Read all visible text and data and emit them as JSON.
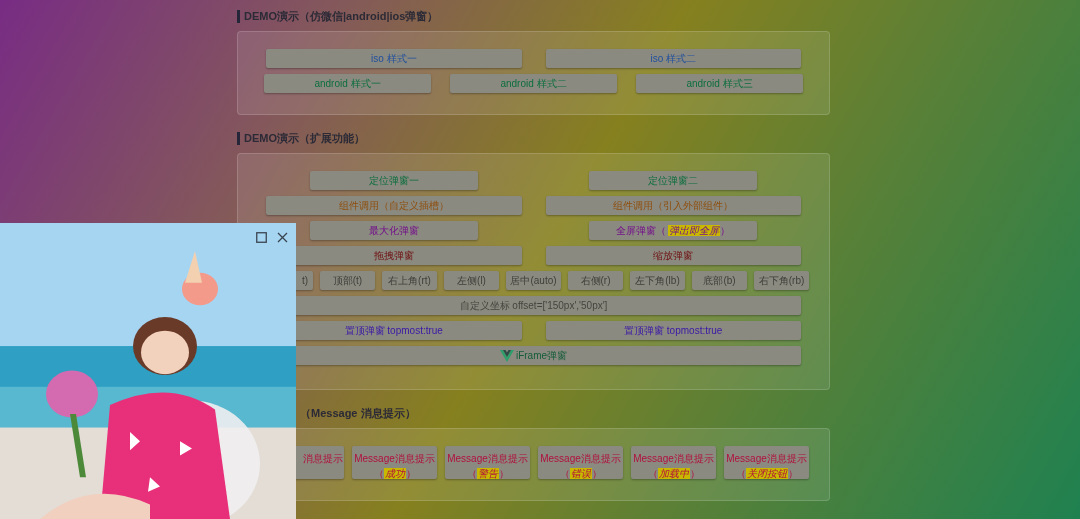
{
  "sections": [
    {
      "title": "DEMO演示（仿微信|android|ios弹窗）",
      "rows": [
        {
          "kind": "halves",
          "buttons": [
            {
              "label": "iso 样式一"
            },
            {
              "label": "iso 样式二"
            }
          ]
        },
        {
          "kind": "thirds",
          "buttons": [
            {
              "label": "android 样式一"
            },
            {
              "label": "android 样式二"
            },
            {
              "label": "android 样式三"
            }
          ]
        }
      ]
    },
    {
      "title": "DEMO演示（扩展功能）",
      "rows": [
        {
          "kind": "narrow",
          "buttons": [
            {
              "label": "定位弹窗一"
            },
            {
              "label": "定位弹窗二"
            }
          ]
        },
        {
          "kind": "halves",
          "buttons": [
            {
              "label": "组件调用（自定义插槽）"
            },
            {
              "label": "组件调用（引入外部组件）"
            }
          ]
        },
        {
          "kind": "narrow",
          "buttons": [
            {
              "label": "最大化弹窗"
            },
            {
              "label": "全屏弹窗（",
              "note": {
                "text": "弹出即全屏",
                "after": "）"
              }
            }
          ]
        },
        {
          "kind": "halves",
          "buttons": [
            {
              "label": "拖拽弹窗"
            },
            {
              "label": "缩放弹窗"
            }
          ]
        },
        {
          "kind": "positions",
          "buttons": [
            {
              "label": "t)"
            },
            {
              "label": "顶部(t)"
            },
            {
              "label": "右上角(rt)"
            },
            {
              "label": "左侧(l)"
            },
            {
              "label": "居中(auto)"
            },
            {
              "label": "右侧(r)"
            },
            {
              "label": "左下角(lb)"
            },
            {
              "label": "底部(b)"
            },
            {
              "label": "右下角(rb)"
            }
          ]
        },
        {
          "kind": "full",
          "buttons": [
            {
              "label": "自定义坐标 offset=['150px','50px']"
            }
          ]
        },
        {
          "kind": "halves",
          "buttons": [
            {
              "label": "置顶弹窗 topmost:true"
            },
            {
              "label": "置顶弹窗 topmost:true"
            }
          ]
        },
        {
          "kind": "full",
          "buttons": [
            {
              "label": "iFrame弹窗"
            }
          ]
        }
      ]
    },
    {
      "title": "（Message 消息提示）",
      "rows": [
        {
          "kind": "messages",
          "buttons": [
            {
              "label": "消息提示"
            },
            {
              "label": "Message消息提示",
              "note": {
                "before": "（",
                "text": "成功",
                "after": "）"
              }
            },
            {
              "label": "Message消息提示",
              "note": {
                "before": "（",
                "text": "警告",
                "after": "）"
              }
            },
            {
              "label": "Message消息提示",
              "note": {
                "before": "（",
                "text": "错误",
                "after": "）"
              }
            },
            {
              "label": "Message消息提示",
              "note": {
                "before": "（",
                "text": "加载中",
                "after": "）"
              }
            },
            {
              "label": "Message消息提示",
              "note": {
                "before": "（",
                "text": "关闭按钮",
                "after": "）"
              }
            }
          ]
        }
      ]
    }
  ]
}
